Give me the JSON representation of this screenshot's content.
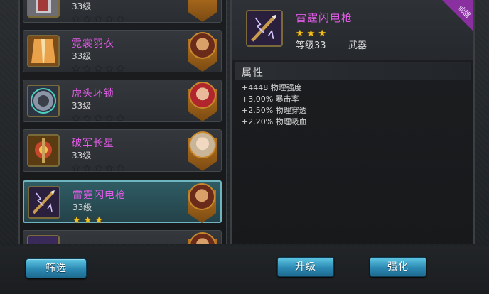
{
  "inventory": {
    "items": [
      {
        "name": "",
        "level": "33级",
        "stars": 0
      },
      {
        "name": "霓裳羽衣",
        "level": "33级",
        "stars": 0
      },
      {
        "name": "虎头环锁",
        "level": "33级",
        "stars": 0
      },
      {
        "name": "破军长星",
        "level": "33级",
        "stars": 0
      },
      {
        "name": "雷霆闪电枪",
        "level": "33级",
        "stars": 3
      },
      {
        "name": "",
        "level": "",
        "stars": 0
      }
    ],
    "filter_label": "筛选"
  },
  "detail": {
    "name": "雷霆闪电枪",
    "stars": 3,
    "level": "等级33",
    "type": "武器",
    "corner_tag": "仙器",
    "attributes_title": "属性",
    "attributes": [
      "+4448 物理强度",
      "+3.00% 暴击率",
      "+2.50% 物理穿透",
      "+2.20% 物理吸血"
    ],
    "upgrade_label": "升级",
    "enhance_label": "强化"
  },
  "colors": {
    "item_name": "#e15be6",
    "star_on": "#f5c21b",
    "button": "#2b89b3",
    "selected_row": "#2f5c64"
  }
}
